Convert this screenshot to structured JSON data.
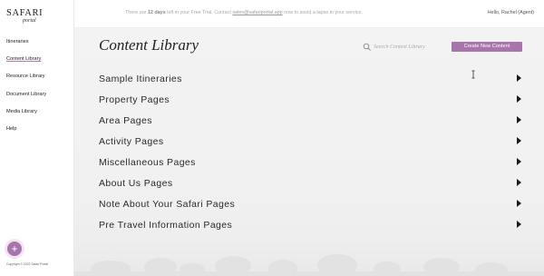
{
  "brand": {
    "name": "SAFARI",
    "sub": "portal"
  },
  "sidebar": {
    "items": [
      {
        "label": "Itineraries"
      },
      {
        "label": "Content Library",
        "active": true
      },
      {
        "label": "Resource Library"
      },
      {
        "label": "Document Library"
      },
      {
        "label": "Media Library"
      },
      {
        "label": "Help"
      }
    ],
    "fab_icon": "plus-icon",
    "copyright": "Copyright © 2022 Safari Portal"
  },
  "topbar": {
    "trial_prefix": "There are ",
    "trial_days": "12 days",
    "trial_middle": " left in your Free Trial. Contact ",
    "trial_email": "sales@safariportal.app",
    "trial_suffix": " now to avoid a lapse in your service.",
    "user_greeting": "Hello, Rachel (Agent)"
  },
  "main": {
    "title": "Content Library",
    "search_placeholder": "Search Content Library",
    "create_button": "Create New Content",
    "rows": [
      {
        "label": "Sample Itineraries"
      },
      {
        "label": "Property Pages"
      },
      {
        "label": "Area Pages"
      },
      {
        "label": "Activity Pages"
      },
      {
        "label": "Miscellaneous Pages"
      },
      {
        "label": "About Us Pages"
      },
      {
        "label": "Note About Your Safari Pages"
      },
      {
        "label": "Pre Travel Information Pages"
      }
    ]
  },
  "colors": {
    "accent": "#a874ac",
    "background": "#f2f2f2"
  }
}
